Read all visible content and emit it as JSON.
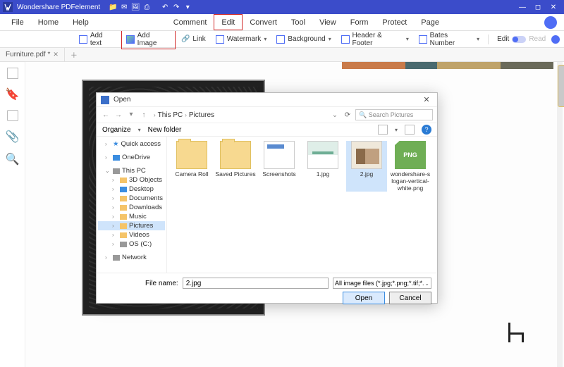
{
  "app": {
    "title": "Wondershare PDFelement"
  },
  "titlebar_icons": [
    "folder",
    "mail",
    "image",
    "printer",
    "undo",
    "redo",
    "dropdown"
  ],
  "menubar": {
    "file": "File",
    "home": "Home",
    "help": "Help",
    "comment": "Comment",
    "edit": "Edit",
    "convert": "Convert",
    "tool": "Tool",
    "view": "View",
    "form": "Form",
    "protect": "Protect",
    "page": "Page"
  },
  "toolbar": {
    "add_text": "Add text",
    "add_image": "Add Image",
    "link": "Link",
    "watermark": "Watermark",
    "background": "Background",
    "header_footer": "Header & Footer",
    "bates": "Bates Number",
    "edit": "Edit",
    "read": "Read"
  },
  "tab": {
    "name": "Furniture.pdf *"
  },
  "dialog": {
    "title": "Open",
    "crumbs": [
      "This PC",
      "Pictures"
    ],
    "search_placeholder": "Search Pictures",
    "organize": "Organize",
    "new_folder": "New folder",
    "tree": {
      "quick": "Quick access",
      "onedrive": "OneDrive",
      "thispc": "This PC",
      "objects3d": "3D Objects",
      "desktop": "Desktop",
      "documents": "Documents",
      "downloads": "Downloads",
      "music": "Music",
      "pictures": "Pictures",
      "videos": "Videos",
      "osc": "OS (C:)",
      "network": "Network"
    },
    "items": [
      {
        "label": "Camera Roll",
        "kind": "folder"
      },
      {
        "label": "Saved Pictures",
        "kind": "folder"
      },
      {
        "label": "Screenshots",
        "kind": "ss"
      },
      {
        "label": "1.jpg",
        "kind": "img1"
      },
      {
        "label": "2.jpg",
        "kind": "img2",
        "selected": true
      },
      {
        "label": "wondershare-slogan-vertical-white.png",
        "kind": "png"
      }
    ],
    "filename_label": "File name:",
    "filename_value": "2.jpg",
    "filter": "All image files (*.jpg;*.png;*.tif;*.",
    "open": "Open",
    "cancel": "Cancel"
  }
}
